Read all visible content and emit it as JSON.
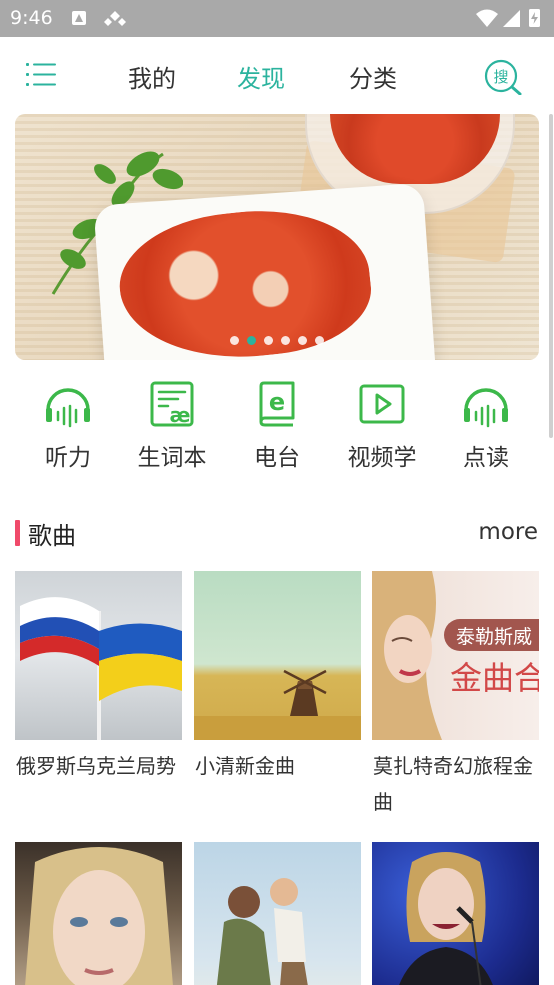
{
  "status_bar": {
    "time": "9:46",
    "icons": [
      "app-a-icon",
      "wireless-diamond-icon",
      "wifi-icon",
      "signal-icon",
      "battery-charging-icon"
    ]
  },
  "nav": {
    "menu_icon": "menu-list-icon",
    "tabs": [
      {
        "label": "我的",
        "active": false
      },
      {
        "label": "发现",
        "active": true
      },
      {
        "label": "分类",
        "active": false
      }
    ],
    "search_glyph": "搜",
    "accent_color": "#2bb39e"
  },
  "banner": {
    "slide_count": 6,
    "active_index": 1
  },
  "features": [
    {
      "label": "听力",
      "icon": "headphones-icon"
    },
    {
      "label": "生词本",
      "icon": "vocabulary-book-icon"
    },
    {
      "label": "电台",
      "icon": "radio-book-icon"
    },
    {
      "label": "视频学",
      "icon": "video-play-icon"
    },
    {
      "label": "点读",
      "icon": "headphones-icon"
    }
  ],
  "section": {
    "title": "歌曲",
    "more": "more",
    "bar_color": "#f04a6a"
  },
  "songs": [
    {
      "title": "俄罗斯乌克兰局势",
      "image": "flags-photo"
    },
    {
      "title": "小清新金曲",
      "image": "windmill-field-photo"
    },
    {
      "title": "莫扎特奇幻旅程金曲",
      "image": "taylor-swift-cover",
      "overlay_top": "泰勒斯威",
      "overlay_main": "金曲合"
    },
    {
      "title": "",
      "image": "blonde-woman-portrait"
    },
    {
      "title": "",
      "image": "mother-child-photo"
    },
    {
      "title": "",
      "image": "singer-on-stage-photo"
    }
  ]
}
